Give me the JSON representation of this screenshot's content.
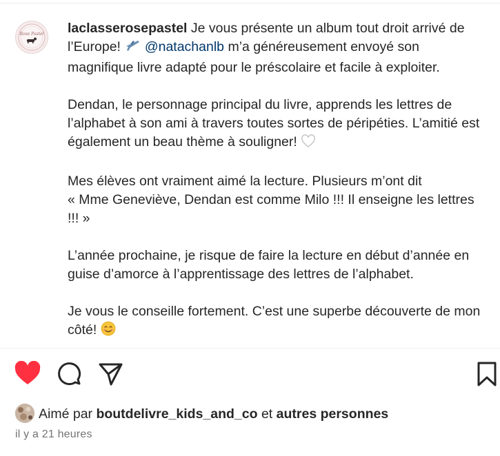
{
  "post": {
    "username": "laclasserosepastel",
    "avatar_icon": "rose-pastel-logo-icon",
    "avatar_text": "Rose Pastel",
    "caption": {
      "p1_a": " Je vous présente un album tout droit arrivé de l’Europe! ",
      "p1_mention": "@natachanlb",
      "p1_b": " m’a généreusement envoyé son magnifique livre adapté pour le préscolaire et facile à exploiter.",
      "p2": "Dendan, le personnage principal du livre, apprends les lettres de l’alphabet à son ami à travers toutes sortes de péripéties. L’amitié est également un beau thème à souligner! ",
      "p3_a": "Mes élèves ont vraiment aimé la lecture. Plusieurs m’ont dit",
      "p3_b": "« Mme Geneviève, Dendan est comme Milo !!! Il enseigne les lettres !!! »",
      "p4": "L’année prochaine, je risque de faire la lecture en début d’année en guise d’amorce à l’apprentissage des lettres de l’alphabet.",
      "p5": "Je vous le conseille fortement. C’est une superbe découverte de mon côté! "
    },
    "emojis": [
      "airplane-emoji",
      "white-heart-emoji",
      "smiling-face-emoji"
    ]
  },
  "actions": {
    "like_icon": "heart-filled-icon",
    "comment_icon": "comment-icon",
    "share_icon": "paper-plane-icon",
    "save_icon": "bookmark-icon",
    "like_color": "#ff3040"
  },
  "likes": {
    "prefix": "Aimé par ",
    "user": "boutdelivre_kids_and_co",
    "middle": " et ",
    "others": "autres personnes"
  },
  "timestamp": "il y a 21 heures"
}
